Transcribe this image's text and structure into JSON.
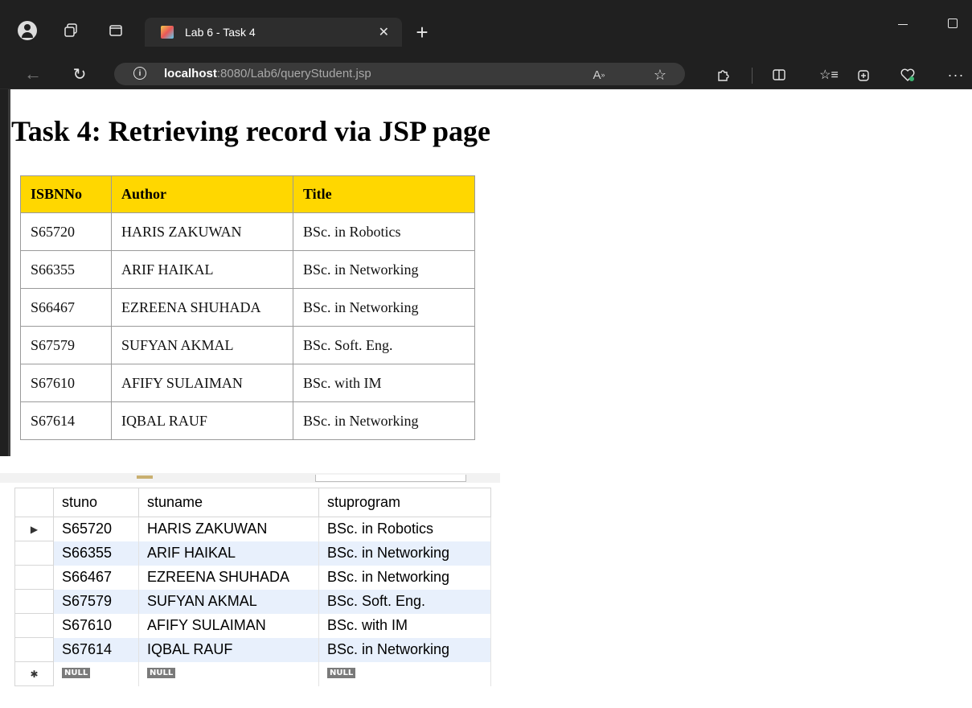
{
  "browser": {
    "tab_title": "Lab 6 - Task 4",
    "url_host": "localhost",
    "url_path": ":8080/Lab6/queryStudent.jsp",
    "icons": [
      "profile-icon",
      "workspaces-icon",
      "tab-actions-icon",
      "close-icon",
      "plus-icon",
      "minimize-icon",
      "maximize-icon",
      "back-icon",
      "refresh-icon",
      "info-icon",
      "read-aloud-icon",
      "star-icon",
      "extensions-icon",
      "split-screen-icon",
      "favorites-icon",
      "collections-icon",
      "browser-essentials-icon",
      "more-icon"
    ]
  },
  "page": {
    "title": "Task 4: Retrieving record via JSP page",
    "header_color": "#ffd700",
    "table": {
      "columns": [
        "ISBNNo",
        "Author",
        "Title"
      ],
      "rows": [
        [
          "S65720",
          "HARIS ZAKUWAN",
          "BSc. in Robotics"
        ],
        [
          "S66355",
          "ARIF HAIKAL",
          "BSc. in Networking"
        ],
        [
          "S66467",
          "EZREENA SHUHADA",
          "BSc. in Networking"
        ],
        [
          "S67579",
          "SUFYAN AKMAL",
          "BSc. Soft. Eng."
        ],
        [
          "S67610",
          "AFIFY SULAIMAN",
          "BSc. with IM"
        ],
        [
          "S67614",
          "IQBAL RAUF",
          "BSc. in Networking"
        ]
      ]
    }
  },
  "db_grid": {
    "columns": [
      "stuno",
      "stuname",
      "stuprogram"
    ],
    "rows": [
      [
        "S65720",
        "HARIS ZAKUWAN",
        "BSc. in Robotics"
      ],
      [
        "S66355",
        "ARIF HAIKAL",
        "BSc. in Networking"
      ],
      [
        "S66467",
        "EZREENA SHUHADA",
        "BSc. in Networking"
      ],
      [
        "S67579",
        "SUFYAN AKMAL",
        "BSc. Soft. Eng."
      ],
      [
        "S67610",
        "AFIFY SULAIMAN",
        "BSc. with IM"
      ],
      [
        "S67614",
        "IQBAL RAUF",
        "BSc. in Networking"
      ]
    ],
    "null_label": "NULL",
    "current_row_marker": "▶",
    "new_row_marker": "✱",
    "alt_row_color": "#e8f0fc"
  }
}
